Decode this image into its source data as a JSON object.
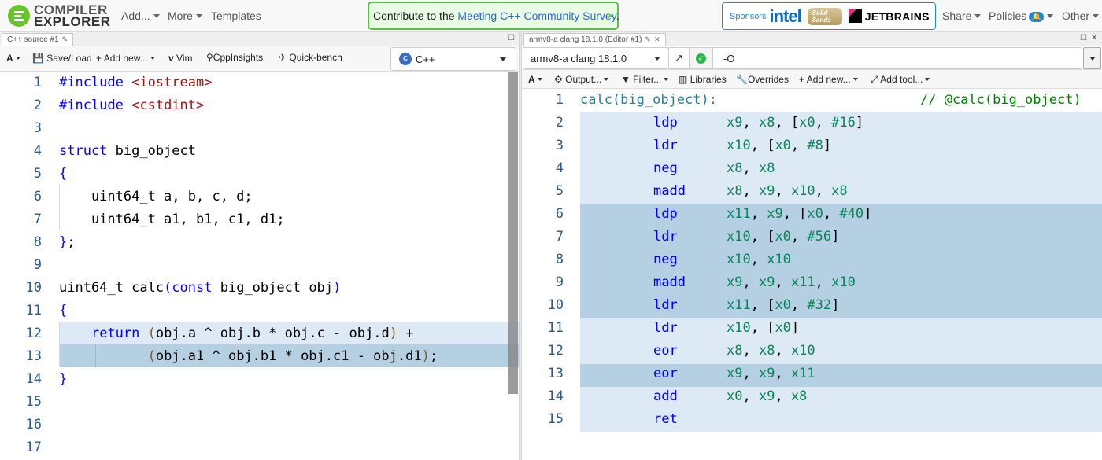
{
  "brand": {
    "line1": "COMPILER",
    "line2": "EXPLORER"
  },
  "nav": {
    "add": "Add...",
    "more": "More",
    "templates": "Templates",
    "share": "Share",
    "policies": "Policies",
    "other": "Other"
  },
  "survey": {
    "prefix": "Contribute to the ",
    "link": "Meeting C++ Community Survey",
    "suffix": ".",
    "close": "×"
  },
  "sponsors": {
    "label": "Sponsors",
    "s1": "intel",
    "s2a": "Solid",
    "s2b": "Sands",
    "s3": "JETBRAINS"
  },
  "left": {
    "tab_title": "C++ source #1",
    "toolbar": {
      "font": "A",
      "save": "Save/Load",
      "add_new": "Add new...",
      "vim": "Vim",
      "cppinsights": "CppInsights",
      "quickbench": "Quick-bench"
    },
    "language": "C++",
    "line_numbers": [
      "1",
      "2",
      "3",
      "4",
      "5",
      "6",
      "7",
      "8",
      "9",
      "10",
      "11",
      "12",
      "13",
      "14",
      "15",
      "16",
      "17"
    ]
  },
  "right": {
    "tab_title": "armv8-a clang 18.1.0 (Editor #1)",
    "compiler": "armv8-a clang 18.1.0",
    "options": "-O",
    "toolbar": {
      "font": "A",
      "output": "Output...",
      "filter": "Filter...",
      "libraries": "Libraries",
      "overrides": "Overrides",
      "add_new": "Add new...",
      "add_tool": "Add tool..."
    },
    "line_numbers": [
      "1",
      "2",
      "3",
      "4",
      "5",
      "6",
      "7",
      "8",
      "9",
      "10",
      "11",
      "12",
      "13",
      "14",
      "15"
    ],
    "asm": {
      "label": "calc(big_object):",
      "comment": "// @calc(big_object)",
      "rows": [
        {
          "m": "ldp",
          "o": "x9, x8, [x0, #16]"
        },
        {
          "m": "ldr",
          "o": "x10, [x0, #8]"
        },
        {
          "m": "neg",
          "o": "x8, x8"
        },
        {
          "m": "madd",
          "o": "x8, x9, x10, x8"
        },
        {
          "m": "ldp",
          "o": "x11, x9, [x0, #40]"
        },
        {
          "m": "ldr",
          "o": "x10, [x0, #56]"
        },
        {
          "m": "neg",
          "o": "x10, x10"
        },
        {
          "m": "madd",
          "o": "x9, x9, x11, x10"
        },
        {
          "m": "ldr",
          "o": "x11, [x0, #32]"
        },
        {
          "m": "ldr",
          "o": "x10, [x0]"
        },
        {
          "m": "eor",
          "o": "x8, x8, x10"
        },
        {
          "m": "eor",
          "o": "x9, x9, x11"
        },
        {
          "m": "add",
          "o": "x0, x9, x8"
        },
        {
          "m": "ret",
          "o": ""
        }
      ]
    }
  },
  "colors": {
    "accent_green": "#67c52a",
    "highlight_light": "#dde9f4",
    "highlight_dark": "#b5cfe3",
    "keyword": "#0000ff",
    "string": "#a31515",
    "register": "#098658"
  }
}
